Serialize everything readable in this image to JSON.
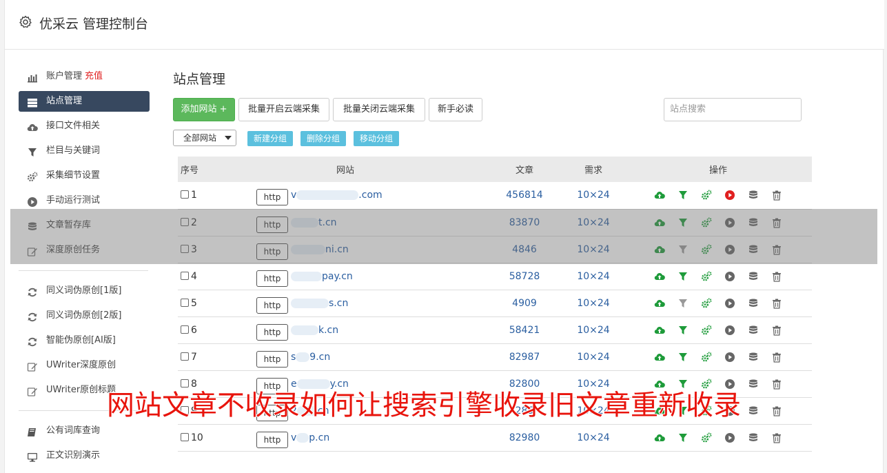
{
  "header": {
    "title": "优采云 管理控制台"
  },
  "sidebar": {
    "items": [
      {
        "label": "账户管理",
        "extra": "充值",
        "icon": "bar-chart-icon"
      },
      {
        "label": "站点管理",
        "icon": "server-list-icon",
        "active": true
      },
      {
        "label": "接口文件相关",
        "icon": "cloud-upload-icon"
      },
      {
        "label": "栏目与关键词",
        "icon": "filter-icon"
      },
      {
        "label": "采集细节设置",
        "icon": "cogs-icon"
      },
      {
        "label": "手动运行测试",
        "icon": "play-circle-icon"
      },
      {
        "label": "文章暂存库",
        "icon": "database-icon"
      },
      {
        "label": "深度原创任务",
        "icon": "edit-icon"
      }
    ],
    "items2": [
      {
        "label": "同义词伪原创[1版]",
        "icon": "refresh-icon"
      },
      {
        "label": "同义词伪原创[2版]",
        "icon": "refresh-icon"
      },
      {
        "label": "智能伪原创[AI版]",
        "icon": "refresh-icon"
      },
      {
        "label": "UWriter深度原创",
        "icon": "edit-icon"
      },
      {
        "label": "UWriter原创标题",
        "icon": "edit-icon"
      }
    ],
    "items3": [
      {
        "label": "公有词库查询",
        "icon": "book-icon"
      },
      {
        "label": "正文识别演示",
        "icon": "monitor-icon"
      }
    ]
  },
  "main": {
    "title": "站点管理",
    "buttons": {
      "add": "添加网站 +",
      "batch_open": "批量开启云端采集",
      "batch_close": "批量关闭云端采集",
      "guide": "新手必读"
    },
    "search_placeholder": "站点搜索",
    "group_select": "全部网站",
    "group_buttons": {
      "new": "新建分组",
      "delete": "删除分组",
      "move": "移动分组"
    },
    "table": {
      "headers": {
        "index": "序号",
        "site": "网站",
        "articles": "文章",
        "demand": "需求",
        "ops": "操作"
      },
      "rows": [
        {
          "index": "1",
          "proto": "http",
          "site_prefix": "v",
          "site_suffix": ".com",
          "articles": "456814",
          "demand": "10×24",
          "play_active": true
        },
        {
          "index": "2",
          "proto": "http",
          "site_prefix": "",
          "site_suffix": "t.cn",
          "articles": "83870",
          "demand": "10×24",
          "play_active": false
        },
        {
          "index": "3",
          "proto": "http",
          "site_prefix": "",
          "site_suffix": "ni.cn",
          "articles": "4846",
          "demand": "10×24",
          "play_active": false
        },
        {
          "index": "4",
          "proto": "http",
          "site_prefix": "",
          "site_suffix": "pay.cn",
          "articles": "58728",
          "demand": "10×24",
          "play_active": false
        },
        {
          "index": "5",
          "proto": "http",
          "site_prefix": "",
          "site_suffix": "s.cn",
          "articles": "4909",
          "demand": "10×24",
          "play_active": false
        },
        {
          "index": "6",
          "proto": "http",
          "site_prefix": "",
          "site_suffix": "k.cn",
          "articles": "58421",
          "demand": "10×24",
          "play_active": false
        },
        {
          "index": "7",
          "proto": "http",
          "site_prefix": "s",
          "site_suffix": "9.cn",
          "articles": "82987",
          "demand": "10×24",
          "play_active": false
        },
        {
          "index": "8",
          "proto": "http",
          "site_prefix": "e",
          "site_suffix": "y.cn",
          "articles": "82800",
          "demand": "10×24",
          "play_active": false
        },
        {
          "index": "9",
          "proto": "http",
          "site_prefix": "2",
          "site_suffix": "cn",
          "articles": "285",
          "demand": "10×24",
          "play_active": false
        },
        {
          "index": "10",
          "proto": "http",
          "site_prefix": "v",
          "site_suffix": "p.cn",
          "articles": "82980",
          "demand": "10×24",
          "play_active": false
        }
      ]
    }
  },
  "banner": {
    "text": "网站文章不收录如何让搜索引擎收录旧文章重新收录"
  },
  "colors": {
    "green": "#1e9b3a",
    "play_gray": "#666666",
    "play_red": "#e02020",
    "sidebar_active": "#37485f"
  }
}
